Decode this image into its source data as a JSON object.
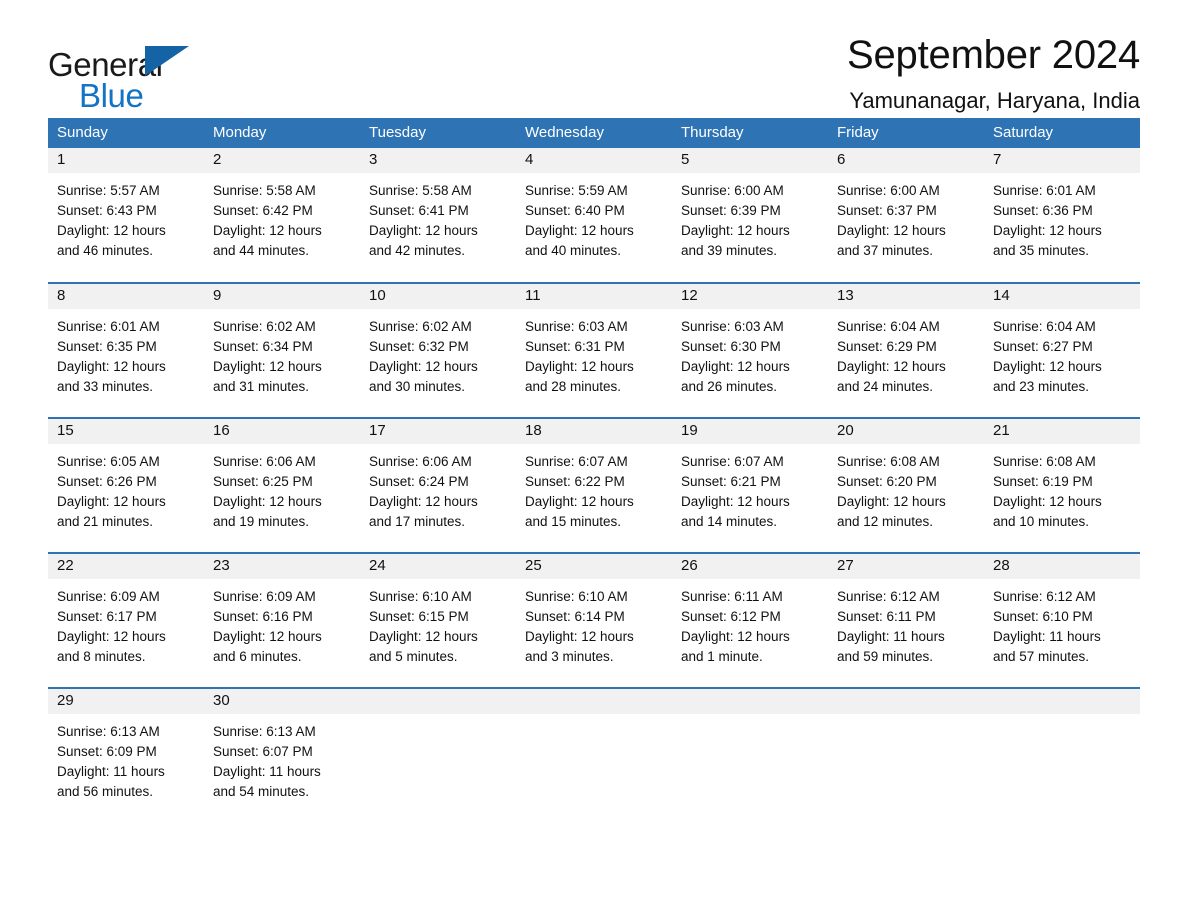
{
  "brand": {
    "name_part1": "General",
    "name_part2": "Blue",
    "triangle_color": "#1464a5",
    "blue_color": "#1474c4"
  },
  "header": {
    "title": "September 2024",
    "subtitle": "Yamunanagar, Haryana, India"
  },
  "theme": {
    "header_blue": "#2e74b5",
    "daynum_gray": "#f1f1f1",
    "text_color": "#111111"
  },
  "weekday_headers": [
    "Sunday",
    "Monday",
    "Tuesday",
    "Wednesday",
    "Thursday",
    "Friday",
    "Saturday"
  ],
  "weeks": [
    [
      {
        "day": "1",
        "sunrise": "Sunrise: 5:57 AM",
        "sunset": "Sunset: 6:43 PM",
        "daylight_line1": "Daylight: 12 hours",
        "daylight_line2": "and 46 minutes."
      },
      {
        "day": "2",
        "sunrise": "Sunrise: 5:58 AM",
        "sunset": "Sunset: 6:42 PM",
        "daylight_line1": "Daylight: 12 hours",
        "daylight_line2": "and 44 minutes."
      },
      {
        "day": "3",
        "sunrise": "Sunrise: 5:58 AM",
        "sunset": "Sunset: 6:41 PM",
        "daylight_line1": "Daylight: 12 hours",
        "daylight_line2": "and 42 minutes."
      },
      {
        "day": "4",
        "sunrise": "Sunrise: 5:59 AM",
        "sunset": "Sunset: 6:40 PM",
        "daylight_line1": "Daylight: 12 hours",
        "daylight_line2": "and 40 minutes."
      },
      {
        "day": "5",
        "sunrise": "Sunrise: 6:00 AM",
        "sunset": "Sunset: 6:39 PM",
        "daylight_line1": "Daylight: 12 hours",
        "daylight_line2": "and 39 minutes."
      },
      {
        "day": "6",
        "sunrise": "Sunrise: 6:00 AM",
        "sunset": "Sunset: 6:37 PM",
        "daylight_line1": "Daylight: 12 hours",
        "daylight_line2": "and 37 minutes."
      },
      {
        "day": "7",
        "sunrise": "Sunrise: 6:01 AM",
        "sunset": "Sunset: 6:36 PM",
        "daylight_line1": "Daylight: 12 hours",
        "daylight_line2": "and 35 minutes."
      }
    ],
    [
      {
        "day": "8",
        "sunrise": "Sunrise: 6:01 AM",
        "sunset": "Sunset: 6:35 PM",
        "daylight_line1": "Daylight: 12 hours",
        "daylight_line2": "and 33 minutes."
      },
      {
        "day": "9",
        "sunrise": "Sunrise: 6:02 AM",
        "sunset": "Sunset: 6:34 PM",
        "daylight_line1": "Daylight: 12 hours",
        "daylight_line2": "and 31 minutes."
      },
      {
        "day": "10",
        "sunrise": "Sunrise: 6:02 AM",
        "sunset": "Sunset: 6:32 PM",
        "daylight_line1": "Daylight: 12 hours",
        "daylight_line2": "and 30 minutes."
      },
      {
        "day": "11",
        "sunrise": "Sunrise: 6:03 AM",
        "sunset": "Sunset: 6:31 PM",
        "daylight_line1": "Daylight: 12 hours",
        "daylight_line2": "and 28 minutes."
      },
      {
        "day": "12",
        "sunrise": "Sunrise: 6:03 AM",
        "sunset": "Sunset: 6:30 PM",
        "daylight_line1": "Daylight: 12 hours",
        "daylight_line2": "and 26 minutes."
      },
      {
        "day": "13",
        "sunrise": "Sunrise: 6:04 AM",
        "sunset": "Sunset: 6:29 PM",
        "daylight_line1": "Daylight: 12 hours",
        "daylight_line2": "and 24 minutes."
      },
      {
        "day": "14",
        "sunrise": "Sunrise: 6:04 AM",
        "sunset": "Sunset: 6:27 PM",
        "daylight_line1": "Daylight: 12 hours",
        "daylight_line2": "and 23 minutes."
      }
    ],
    [
      {
        "day": "15",
        "sunrise": "Sunrise: 6:05 AM",
        "sunset": "Sunset: 6:26 PM",
        "daylight_line1": "Daylight: 12 hours",
        "daylight_line2": "and 21 minutes."
      },
      {
        "day": "16",
        "sunrise": "Sunrise: 6:06 AM",
        "sunset": "Sunset: 6:25 PM",
        "daylight_line1": "Daylight: 12 hours",
        "daylight_line2": "and 19 minutes."
      },
      {
        "day": "17",
        "sunrise": "Sunrise: 6:06 AM",
        "sunset": "Sunset: 6:24 PM",
        "daylight_line1": "Daylight: 12 hours",
        "daylight_line2": "and 17 minutes."
      },
      {
        "day": "18",
        "sunrise": "Sunrise: 6:07 AM",
        "sunset": "Sunset: 6:22 PM",
        "daylight_line1": "Daylight: 12 hours",
        "daylight_line2": "and 15 minutes."
      },
      {
        "day": "19",
        "sunrise": "Sunrise: 6:07 AM",
        "sunset": "Sunset: 6:21 PM",
        "daylight_line1": "Daylight: 12 hours",
        "daylight_line2": "and 14 minutes."
      },
      {
        "day": "20",
        "sunrise": "Sunrise: 6:08 AM",
        "sunset": "Sunset: 6:20 PM",
        "daylight_line1": "Daylight: 12 hours",
        "daylight_line2": "and 12 minutes."
      },
      {
        "day": "21",
        "sunrise": "Sunrise: 6:08 AM",
        "sunset": "Sunset: 6:19 PM",
        "daylight_line1": "Daylight: 12 hours",
        "daylight_line2": "and 10 minutes."
      }
    ],
    [
      {
        "day": "22",
        "sunrise": "Sunrise: 6:09 AM",
        "sunset": "Sunset: 6:17 PM",
        "daylight_line1": "Daylight: 12 hours",
        "daylight_line2": "and 8 minutes."
      },
      {
        "day": "23",
        "sunrise": "Sunrise: 6:09 AM",
        "sunset": "Sunset: 6:16 PM",
        "daylight_line1": "Daylight: 12 hours",
        "daylight_line2": "and 6 minutes."
      },
      {
        "day": "24",
        "sunrise": "Sunrise: 6:10 AM",
        "sunset": "Sunset: 6:15 PM",
        "daylight_line1": "Daylight: 12 hours",
        "daylight_line2": "and 5 minutes."
      },
      {
        "day": "25",
        "sunrise": "Sunrise: 6:10 AM",
        "sunset": "Sunset: 6:14 PM",
        "daylight_line1": "Daylight: 12 hours",
        "daylight_line2": "and 3 minutes."
      },
      {
        "day": "26",
        "sunrise": "Sunrise: 6:11 AM",
        "sunset": "Sunset: 6:12 PM",
        "daylight_line1": "Daylight: 12 hours",
        "daylight_line2": "and 1 minute."
      },
      {
        "day": "27",
        "sunrise": "Sunrise: 6:12 AM",
        "sunset": "Sunset: 6:11 PM",
        "daylight_line1": "Daylight: 11 hours",
        "daylight_line2": "and 59 minutes."
      },
      {
        "day": "28",
        "sunrise": "Sunrise: 6:12 AM",
        "sunset": "Sunset: 6:10 PM",
        "daylight_line1": "Daylight: 11 hours",
        "daylight_line2": "and 57 minutes."
      }
    ],
    [
      {
        "day": "29",
        "sunrise": "Sunrise: 6:13 AM",
        "sunset": "Sunset: 6:09 PM",
        "daylight_line1": "Daylight: 11 hours",
        "daylight_line2": "and 56 minutes."
      },
      {
        "day": "30",
        "sunrise": "Sunrise: 6:13 AM",
        "sunset": "Sunset: 6:07 PM",
        "daylight_line1": "Daylight: 11 hours",
        "daylight_line2": "and 54 minutes."
      },
      {
        "day": "",
        "sunrise": "",
        "sunset": "",
        "daylight_line1": "",
        "daylight_line2": ""
      },
      {
        "day": "",
        "sunrise": "",
        "sunset": "",
        "daylight_line1": "",
        "daylight_line2": ""
      },
      {
        "day": "",
        "sunrise": "",
        "sunset": "",
        "daylight_line1": "",
        "daylight_line2": ""
      },
      {
        "day": "",
        "sunrise": "",
        "sunset": "",
        "daylight_line1": "",
        "daylight_line2": ""
      },
      {
        "day": "",
        "sunrise": "",
        "sunset": "",
        "daylight_line1": "",
        "daylight_line2": ""
      }
    ]
  ]
}
